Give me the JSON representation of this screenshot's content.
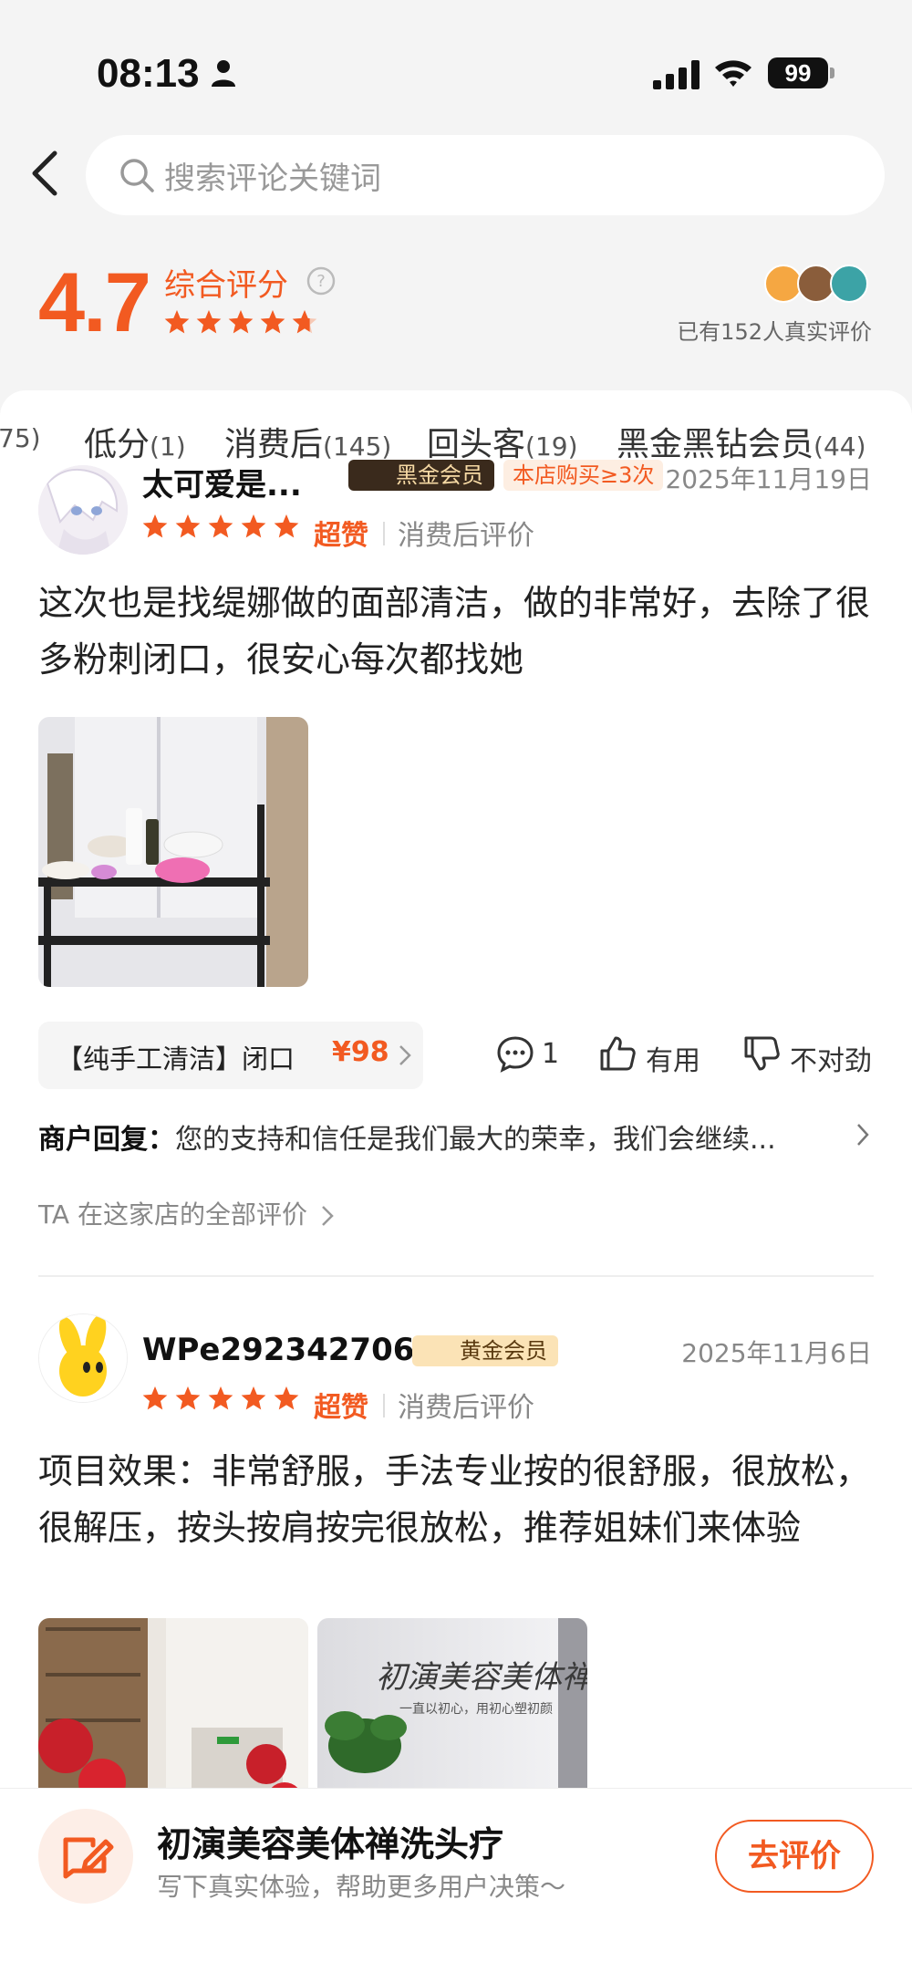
{
  "status_bar": {
    "time": "08:13",
    "battery": "99"
  },
  "search": {
    "placeholder": "搜索评论关键词"
  },
  "rating": {
    "score": "4.7",
    "label": "综合评分",
    "stars": 4.7,
    "real_count_text": "已有152人真实评价"
  },
  "tabs": [
    {
      "label": "",
      "count": "75)"
    },
    {
      "label": "低分",
      "count": "(1)"
    },
    {
      "label": "消费后",
      "count": "(145)"
    },
    {
      "label": "回头客",
      "count": "(19)"
    },
    {
      "label": "黑金黑钻会员",
      "count": "(44)"
    }
  ],
  "reviews": [
    {
      "username": "太可爱是...",
      "badge": "黑金会员",
      "repeat_tag": "本店购买≥3次",
      "date": "2025年11月19日",
      "stars": 5,
      "super_label": "超赞",
      "post_tag": "消费后评价",
      "text": "这次也是找缇娜做的面部清洁，做的非常好，去除了很多粉刺闭口，很安心每次都找她",
      "product": {
        "name": "【纯手工清洁】闭口",
        "price": "¥98"
      },
      "comment_count": "1",
      "useful_label": "有用",
      "wrong_label": "不对劲",
      "merchant_reply_label": "商户回复：",
      "merchant_reply_text": "您的支持和信任是我们最大的荣幸，我们会继续...",
      "all_reviews_link": "TA 在这家店的全部评价"
    },
    {
      "username": "WPe292342706",
      "badge": "黄金会员",
      "date": "2025年11月6日",
      "stars": 5,
      "super_label": "超赞",
      "post_tag": "消费后评价",
      "text": "项目效果：非常舒服，手法专业按的很舒服，很放松，很解压，按头按肩按完很放松，推荐姐妹们来体验",
      "photo_text": {
        "title": "初演美容美体禅洗",
        "slogan": "一直以初心，用初心塑初颜"
      }
    }
  ],
  "bottom_bar": {
    "shop_name": "初演美容美体禅洗头疗",
    "subtitle": "写下真实体验，帮助更多用户决策～",
    "button_label": "去评价"
  },
  "colors": {
    "accent": "#f25a21",
    "black_gold": "#3a2a1c",
    "gold": "#fbe3b6"
  }
}
